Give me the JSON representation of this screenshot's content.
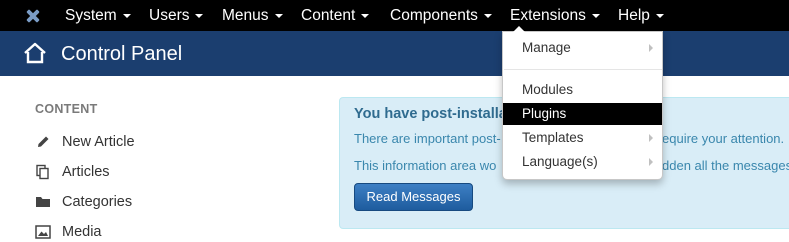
{
  "navbar": {
    "logo": "joomla-logo-icon",
    "items": [
      {
        "label": "System"
      },
      {
        "label": "Users"
      },
      {
        "label": "Menus"
      },
      {
        "label": "Content"
      },
      {
        "label": "Components"
      },
      {
        "label": "Extensions"
      },
      {
        "label": "Help"
      }
    ]
  },
  "header": {
    "icon": "home-icon",
    "title": "Control Panel"
  },
  "sidebar": {
    "heading": "CONTENT",
    "items": [
      {
        "label": "New Article",
        "icon": "pencil-icon"
      },
      {
        "label": "Articles",
        "icon": "copy-icon"
      },
      {
        "label": "Categories",
        "icon": "folder-icon"
      },
      {
        "label": "Media",
        "icon": "image-icon"
      }
    ]
  },
  "alert": {
    "title": "You have post-installa",
    "line1_start": "There are important post-",
    "line1_end": "equire your attention.",
    "line2_start": "This information area wo",
    "line2_end": "dden all the messages",
    "button_label": "Read Messages"
  },
  "extensions_menu": {
    "items": [
      {
        "label": "Manage",
        "submenu": true
      },
      {
        "label": "Modules",
        "submenu": false
      },
      {
        "label": "Plugins",
        "submenu": false,
        "highlighted": true
      },
      {
        "label": "Templates",
        "submenu": true
      },
      {
        "label": "Language(s)",
        "submenu": true
      }
    ]
  },
  "colors": {
    "navbar_bg": "#000000",
    "header_bg": "#1b3e6f",
    "alert_bg": "#d9edf7",
    "alert_text": "#3a87ad",
    "button_bg": "#2a6ab0"
  }
}
